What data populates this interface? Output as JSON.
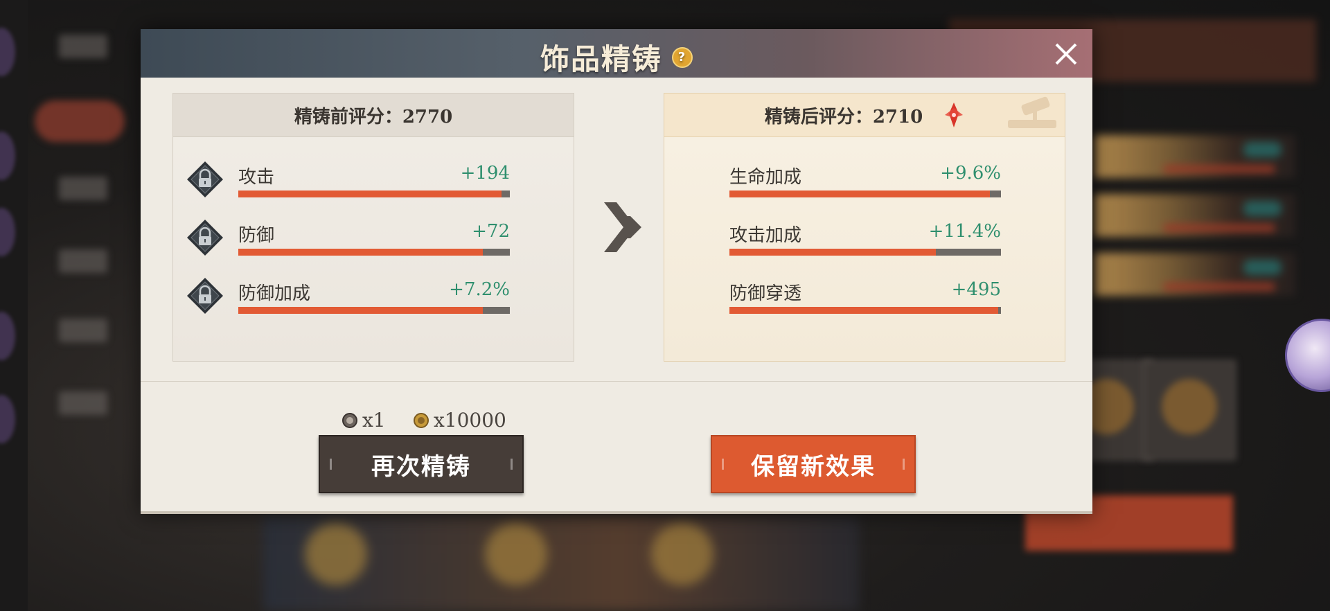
{
  "dialog": {
    "title": "饰品精铸",
    "help_icon": "?",
    "before": {
      "header": "精铸前评分：2770",
      "stats": [
        {
          "name": "攻击",
          "value": "+194",
          "fill": 0.97,
          "locked": true
        },
        {
          "name": "防御",
          "value": "+72",
          "fill": 0.9,
          "locked": true
        },
        {
          "name": "防御加成",
          "value": "+7.2%",
          "fill": 0.9,
          "locked": true
        }
      ]
    },
    "after": {
      "header": "精铸后评分：2710",
      "stats": [
        {
          "name": "生命加成",
          "value": "+9.6%",
          "fill": 0.96
        },
        {
          "name": "攻击加成",
          "value": "+11.4%",
          "fill": 0.76
        },
        {
          "name": "防御穿透",
          "value": "+495",
          "fill": 0.99
        }
      ]
    },
    "costs": [
      {
        "icon": "refine-stone-icon",
        "amount": "x1"
      },
      {
        "icon": "gold-coin-icon",
        "amount": "x10000"
      }
    ],
    "buttons": {
      "refine_again": "再次精铸",
      "keep_new": "保留新效果"
    }
  },
  "colors": {
    "accent_orange": "#dd5a30",
    "stat_value_green": "#2f8f6e",
    "bar_fill": "#e25a34",
    "title_gold": "#f6ecd8"
  }
}
